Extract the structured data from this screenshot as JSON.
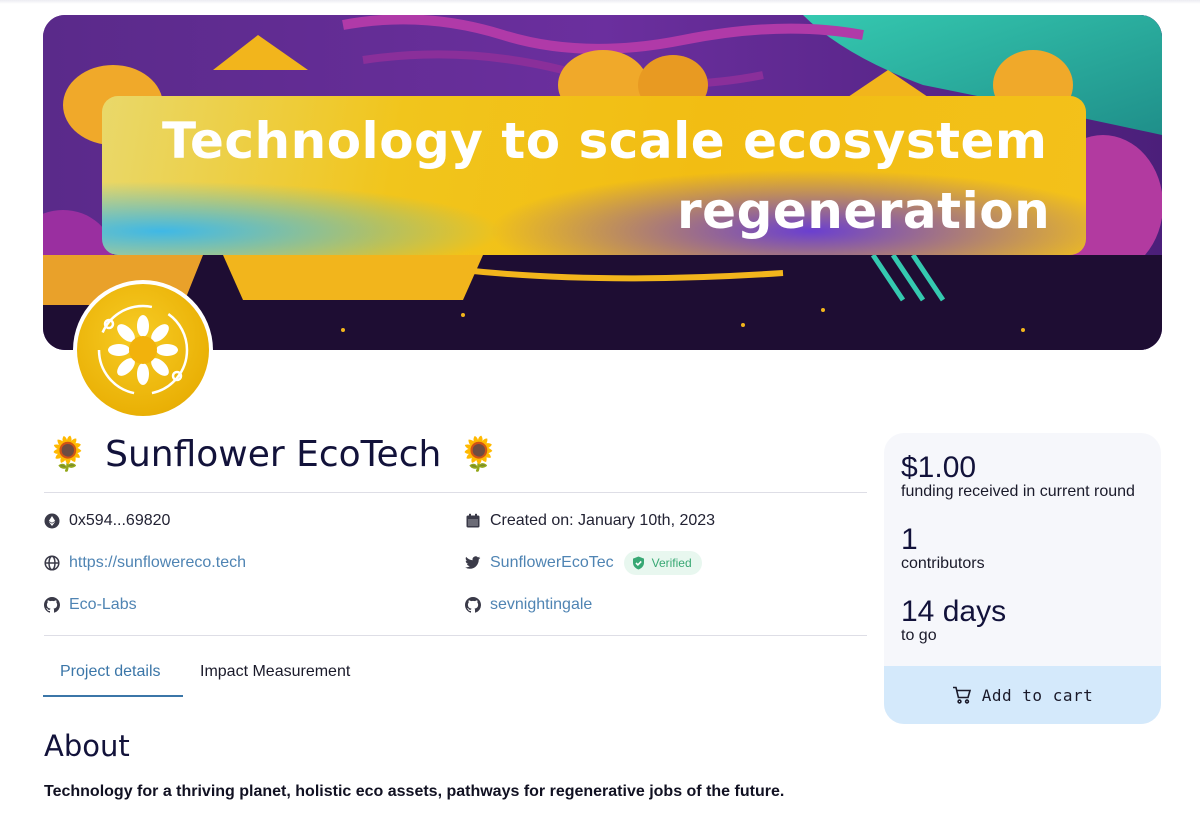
{
  "banner": {
    "line1": "Technology to scale ecosystem",
    "line2": "regeneration"
  },
  "project": {
    "emoji_left": "🌻",
    "name": "Sunflower EcoTech",
    "emoji_right": "🌻"
  },
  "meta": {
    "address": "0x594...69820",
    "created": "Created on: January 10th, 2023",
    "website": "https://sunflowereco.tech",
    "twitter": "SunflowerEcoTec",
    "verified_label": "Verified",
    "github_org": "Eco-Labs",
    "github_user": "sevnightingale"
  },
  "tabs": [
    {
      "label": "Project details",
      "active": true
    },
    {
      "label": "Impact Measurement",
      "active": false
    }
  ],
  "about": {
    "heading": "About",
    "description": "Technology for a thriving planet, holistic eco assets, pathways for regenerative jobs of the future."
  },
  "stats": {
    "funding_amount": "$1.00",
    "funding_label": "funding received in current round",
    "contributors_count": "1",
    "contributors_label": "contributors",
    "days": "14 days",
    "days_label": "to go",
    "cart_label": "Add to cart"
  },
  "colors": {
    "link": "#4f84b3",
    "verified_bg": "#e8f7ef",
    "verified_text": "#38a874",
    "cart_bg": "#d4e9fb",
    "panel_bg": "#f6f7fb"
  },
  "icons": [
    "ethereum-icon",
    "calendar-icon",
    "globe-icon",
    "twitter-icon",
    "shield-check-icon",
    "github-icon",
    "cart-icon"
  ]
}
